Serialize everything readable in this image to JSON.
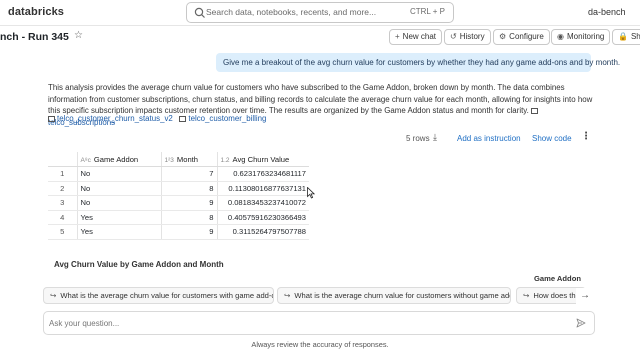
{
  "app": {
    "logo": "databricks",
    "user": "da-bench"
  },
  "search": {
    "placeholder": "Search data, notebooks, recents, and more...",
    "shortcut": "CTRL + P"
  },
  "header": {
    "title": "nch - Run 345",
    "buttons": {
      "new_chat": "New chat",
      "history": "History",
      "configure": "Configure",
      "monitoring": "Monitoring",
      "share": "Sha"
    }
  },
  "conversation": {
    "user_message": "Give me a breakout of the avg churn value for customers by whether they had any game add-ons and by month.",
    "response_text": "This analysis provides the average churn value for customers who have subscribed to the Game Addon, broken down by month. The data combines information from customer subscriptions, churn status, and billing records to calculate the average churn value for each month, allowing for insights into how this specific subscription impacts customer retention over time. The results are organized by the Game Addon status and month for clarity.",
    "tables": [
      "telco_subscriptions",
      "telco_customer_churn_status_v2",
      "telco_customer_billing"
    ]
  },
  "result": {
    "row_count": "5 rows",
    "add_as_instruction": "Add as instruction",
    "show_code": "Show code",
    "columns": [
      {
        "type_icon": "A⁸c",
        "label": "Game Addon"
      },
      {
        "type_icon": "1²3",
        "label": "Month"
      },
      {
        "type_icon": "1.2",
        "label": "Avg Churn Value"
      }
    ],
    "rows": [
      {
        "idx": "1",
        "game_addon": "No",
        "month": "7",
        "avg": "0.6231763234681117"
      },
      {
        "idx": "2",
        "game_addon": "No",
        "month": "8",
        "avg": "0.11308016877637131"
      },
      {
        "idx": "3",
        "game_addon": "No",
        "month": "9",
        "avg": "0.08183453237410072"
      },
      {
        "idx": "4",
        "game_addon": "Yes",
        "month": "8",
        "avg": "0.40575916230366493"
      },
      {
        "idx": "5",
        "game_addon": "Yes",
        "month": "9",
        "avg": "0.3115264797507788"
      }
    ]
  },
  "chart": {
    "title": "Avg Churn Value by Game Addon and Month",
    "legend_title": "Game Addon"
  },
  "suggestions": [
    "What is the average churn value for customers with game add-ons?",
    "What is the average churn value for customers without game add-ons?",
    "How does the"
  ],
  "input": {
    "placeholder": "Ask your question..."
  },
  "footer": {
    "note": "Always review the accuracy of responses."
  }
}
